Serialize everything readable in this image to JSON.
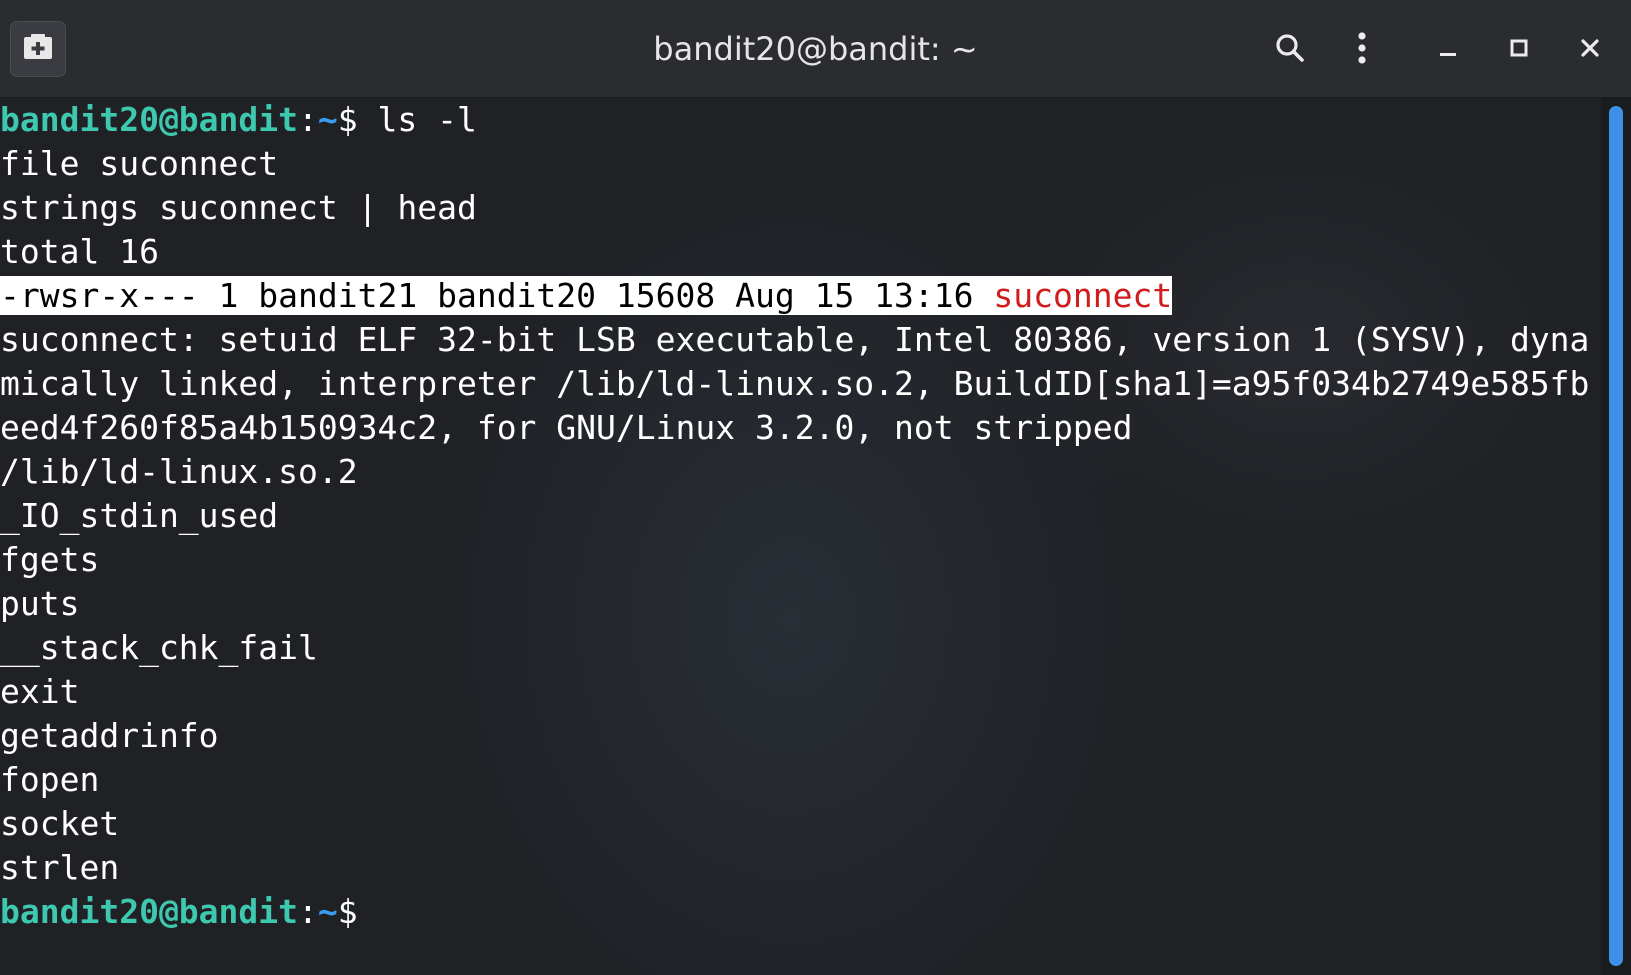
{
  "window": {
    "title": "bandit20@bandit: ~"
  },
  "titlebar_icons": {
    "new_tab": "new-tab-icon",
    "search": "search-icon",
    "menu": "vertical-dots-menu-icon",
    "minimize": "minimize-icon",
    "maximize": "maximize-icon",
    "close": "close-icon"
  },
  "colors": {
    "prompt_user": "#3ec8b0",
    "prompt_path": "#3d9ef0",
    "highlight_bg": "#ffffff",
    "highlight_file": "#d01c1c",
    "scrollbar": "#3d8fe8"
  },
  "terminal": {
    "prompt": {
      "user_host": "bandit20@bandit",
      "sep": ":",
      "path": "~",
      "sigil": "$"
    },
    "command": " ls -l",
    "lines": [
      "file suconnect",
      "strings suconnect | head",
      "total 16"
    ],
    "ls_row": {
      "meta": "-rwsr-x--- 1 bandit21 bandit20 15608 Aug 15 13:16 ",
      "filename": "suconnect"
    },
    "output": [
      "suconnect: setuid ELF 32-bit LSB executable, Intel 80386, version 1 (SYSV), dyna",
      "mically linked, interpreter /lib/ld-linux.so.2, BuildID[sha1]=a95f034b2749e585fb",
      "eed4f260f85a4b150934c2, for GNU/Linux 3.2.0, not stripped",
      "/lib/ld-linux.so.2",
      "_IO_stdin_used",
      "fgets",
      "puts",
      "__stack_chk_fail",
      "exit",
      "getaddrinfo",
      "fopen",
      "socket",
      "strlen"
    ]
  }
}
